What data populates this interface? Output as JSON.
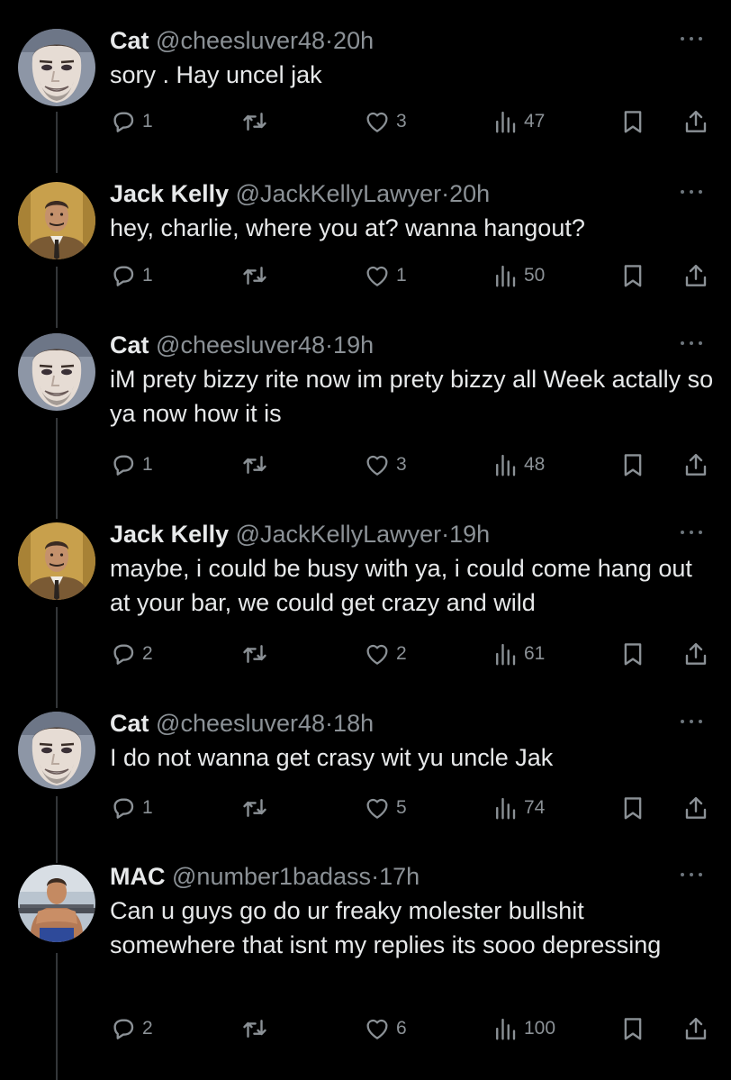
{
  "colors": {
    "background": "#000000",
    "text_primary": "#e7e9ea",
    "text_secondary": "#8b9196",
    "thread_line": "#333639"
  },
  "icons": {
    "reply": "speech-bubble-icon",
    "repost": "repost-arrows-icon",
    "like": "heart-icon",
    "views": "bar-chart-icon",
    "bookmark": "bookmark-icon",
    "share": "share-upload-icon",
    "more": "more-dots-icon"
  },
  "tweets": [
    {
      "name": "Cat",
      "handle": "@cheesluver48",
      "sep": "·",
      "time": "20h",
      "text": "sory . Hay uncel jak",
      "replies": "1",
      "reposts": "",
      "likes": "3",
      "views": "47"
    },
    {
      "name": "Jack Kelly",
      "handle": "@JackKellyLawyer",
      "sep": "·",
      "time": "20h",
      "text": "hey, charlie, where you at? wanna hangout?",
      "replies": "1",
      "reposts": "",
      "likes": "1",
      "views": "50"
    },
    {
      "name": "Cat",
      "handle": "@cheesluver48",
      "sep": "·",
      "time": "19h",
      "text": "iM prety bizzy rite now im prety bizzy all Week actally so ya now how it is",
      "replies": "1",
      "reposts": "",
      "likes": "3",
      "views": "48"
    },
    {
      "name": "Jack Kelly",
      "handle": "@JackKellyLawyer",
      "sep": "·",
      "time": "19h",
      "text": "maybe, i could be busy with ya, i could come hang out at your bar, we could get crazy and wild",
      "replies": "2",
      "reposts": "",
      "likes": "2",
      "views": "61"
    },
    {
      "name": "Cat",
      "handle": "@cheesluver48",
      "sep": "·",
      "time": "18h",
      "text": "I do not wanna get crasy wit yu uncle Jak",
      "replies": "1",
      "reposts": "",
      "likes": "5",
      "views": "74"
    },
    {
      "name": "MAC",
      "handle": "@number1badass",
      "sep": "·",
      "time": "17h",
      "text": "Can u guys go do ur freaky molester bullshit somewhere that isnt my replies its sooo depressing",
      "replies": "2",
      "reposts": "",
      "likes": "6",
      "views": "100"
    }
  ]
}
